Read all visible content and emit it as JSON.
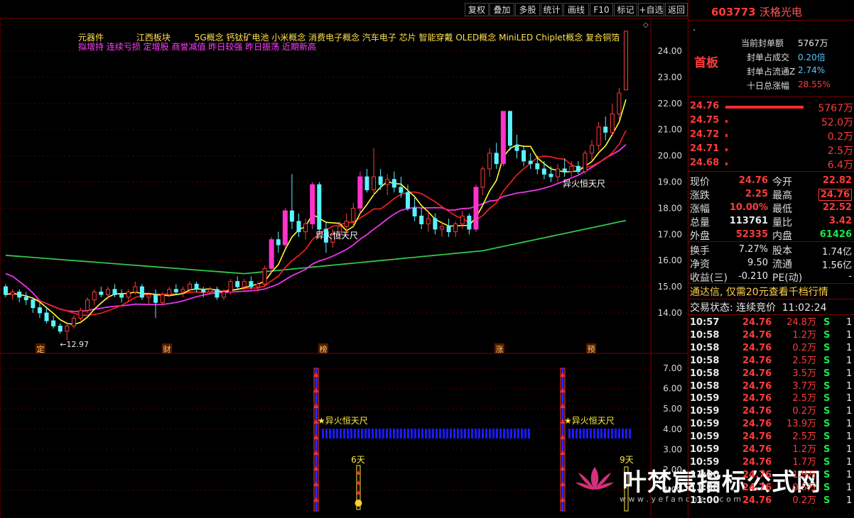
{
  "toolbar": {
    "buttons": [
      "复权",
      "叠加",
      "多股",
      "统计",
      "画线",
      "F10",
      "标记",
      "+自选",
      "返回"
    ]
  },
  "stock": {
    "code": "603773",
    "name": "沃格光电",
    "board": "首板"
  },
  "seal": [
    {
      "label": "当前封单额",
      "value": "5767万"
    },
    {
      "label": "封单占成交",
      "value": "0.20倍"
    },
    {
      "label": "封单占流通Z",
      "value": "2.74%"
    },
    {
      "label": "十日总涨幅",
      "value": "28.55%"
    }
  ],
  "bids": [
    {
      "price": "24.76",
      "vol": "5767万",
      "bar": 1.0
    },
    {
      "price": "24.75",
      "vol": "52.0万",
      "bar": 0.0
    },
    {
      "price": "24.72",
      "vol": "0.2万",
      "bar": 0.0
    },
    {
      "price": "24.71",
      "vol": "2.5万",
      "bar": 0.0
    },
    {
      "price": "24.68",
      "vol": "6.4万",
      "bar": 0.0
    }
  ],
  "quote": [
    {
      "l1": "现价",
      "v1": "24.76",
      "c1": "red",
      "l2": "今开",
      "v2": "22.82",
      "c2": "red"
    },
    {
      "l1": "涨跌",
      "v1": "2.25",
      "c1": "red",
      "l2": "最高",
      "v2": "24.76",
      "c2": "red"
    },
    {
      "l1": "涨幅",
      "v1": "10.00%",
      "c1": "red",
      "l2": "最低",
      "v2": "22.52",
      "c2": "red"
    },
    {
      "l1": "总量",
      "v1": "113761",
      "c1": "wht",
      "l2": "量比",
      "v2": "3.42",
      "c2": "red"
    },
    {
      "l1": "外盘",
      "v1": "52335",
      "c1": "red",
      "l2": "内盘",
      "v2": "61426",
      "c2": "grn"
    }
  ],
  "fund": [
    {
      "l1": "换手",
      "v1": "7.27%",
      "l2": "股本",
      "v2": "1.74亿"
    },
    {
      "l1": "净资",
      "v1": "9.50",
      "l2": "流通",
      "v2": "1.56亿"
    },
    {
      "l1": "收益(三)",
      "v1": "-0.210",
      "l2": "PE(动)",
      "v2": "-"
    }
  ],
  "notice": "通达信, 仅需20元查看千档行情",
  "status": {
    "label": "交易状态: 连续竞价",
    "time": "11:02:24"
  },
  "ticks": [
    {
      "t": "10:57",
      "p": "24.76",
      "v": "24.8万",
      "s": "S",
      "n": "1"
    },
    {
      "t": "10:58",
      "p": "24.76",
      "v": "1.2万",
      "s": "S",
      "n": "1"
    },
    {
      "t": "10:58",
      "p": "24.76",
      "v": "0.2万",
      "s": "S",
      "n": "1"
    },
    {
      "t": "10:58",
      "p": "24.76",
      "v": "2.5万",
      "s": "S",
      "n": "1"
    },
    {
      "t": "10:58",
      "p": "24.76",
      "v": "3.5万",
      "s": "S",
      "n": "1"
    },
    {
      "t": "10:58",
      "p": "24.76",
      "v": "3.7万",
      "s": "S",
      "n": "1"
    },
    {
      "t": "10:59",
      "p": "24.76",
      "v": "2.5万",
      "s": "S",
      "n": "1"
    },
    {
      "t": "10:59",
      "p": "24.76",
      "v": "0.2万",
      "s": "S",
      "n": "1"
    },
    {
      "t": "10:59",
      "p": "24.76",
      "v": "13.9万",
      "s": "S",
      "n": "1"
    },
    {
      "t": "10:59",
      "p": "24.76",
      "v": "2.5万",
      "s": "S",
      "n": "1"
    },
    {
      "t": "10:59",
      "p": "24.76",
      "v": "1.2万",
      "s": "S",
      "n": "1"
    },
    {
      "t": "10:59",
      "p": "24.76",
      "v": "1.7万",
      "s": "S",
      "n": "1"
    },
    {
      "t": "11:00",
      "p": "24.76",
      "v": "1.9万",
      "s": "S",
      "n": "1"
    },
    {
      "t": "11:00",
      "p": "24.76",
      "v": "0.5万",
      "s": "S",
      "n": "1"
    },
    {
      "t": "11:00",
      "p": "24.76",
      "v": "0.2万",
      "s": "S",
      "n": "1"
    }
  ],
  "concepts": {
    "line1": [
      "元器件",
      "江西板块",
      "5G概念 钙钛矿电池 小米概念 消费电子概念 汽车电子 芯片 智能穿戴 OLED概念 MiniLED Chiplet概念 复合铜箔"
    ],
    "line2": "拟增持 连续亏损 定增股 商誉减值 昨日较强 昨日振荡 近期新高"
  },
  "markers": {
    "low": "12.97",
    "signal": "异火恒天尺",
    "days1": "6天",
    "days2": "9天",
    "bottom": [
      "定",
      "财",
      "榜",
      "涨",
      "预"
    ]
  },
  "watermark": {
    "text": "叶梵宸指标公式网",
    "url": "w w w . y e f a n c h e n . c o m"
  },
  "colors": {
    "up": "#ff3b3b",
    "down": "#5cf2ff",
    "ma5": "#ffff33",
    "ma10": "#ff2020",
    "ma20": "#ee33ee",
    "ma60": "#2fc84a",
    "signal": "#ff33cc",
    "label": "#ffd24a"
  },
  "chart_data": {
    "type": "candlestick",
    "yaxis_main": [
      "24.00",
      "23.00",
      "22.00",
      "21.00",
      "20.00",
      "19.00",
      "18.00",
      "17.00",
      "16.00",
      "15.00",
      "14.00"
    ],
    "yaxis_sub": [
      "7.00",
      "6.00",
      "5.00",
      "4.00",
      "3.00",
      "2.00",
      "1.00"
    ],
    "ohlc": [
      [
        15.0,
        15.1,
        14.6,
        14.7
      ],
      [
        14.7,
        14.9,
        14.5,
        14.8
      ],
      [
        14.8,
        14.9,
        14.4,
        14.6
      ],
      [
        14.6,
        14.8,
        14.3,
        14.5
      ],
      [
        14.5,
        14.6,
        14.0,
        14.2
      ],
      [
        14.2,
        14.4,
        13.8,
        14.0
      ],
      [
        14.0,
        14.2,
        13.6,
        13.7
      ],
      [
        13.7,
        13.9,
        13.4,
        13.5
      ],
      [
        13.5,
        13.6,
        13.2,
        13.3
      ],
      [
        13.3,
        13.6,
        12.97,
        13.5
      ],
      [
        13.5,
        13.9,
        13.4,
        13.8
      ],
      [
        13.8,
        14.2,
        13.7,
        14.1
      ],
      [
        14.1,
        14.6,
        14.0,
        14.5
      ],
      [
        14.5,
        14.9,
        14.3,
        14.8
      ],
      [
        14.8,
        15.0,
        14.6,
        14.7
      ],
      [
        14.7,
        15.0,
        14.5,
        14.9
      ],
      [
        14.9,
        15.1,
        14.6,
        14.7
      ],
      [
        14.7,
        14.9,
        14.4,
        14.6
      ],
      [
        14.6,
        14.9,
        14.4,
        14.8
      ],
      [
        14.8,
        15.2,
        14.7,
        15.0
      ],
      [
        15.0,
        15.1,
        14.5,
        14.6
      ],
      [
        14.6,
        14.8,
        14.3,
        14.7
      ],
      [
        14.7,
        14.9,
        13.8,
        14.4
      ],
      [
        14.4,
        14.8,
        14.3,
        14.7
      ],
      [
        14.7,
        15.0,
        14.6,
        14.9
      ],
      [
        14.9,
        15.1,
        14.7,
        14.8
      ],
      [
        14.8,
        15.0,
        14.6,
        14.9
      ],
      [
        14.9,
        15.2,
        14.8,
        15.1
      ],
      [
        15.1,
        15.2,
        14.8,
        14.9
      ],
      [
        14.9,
        15.0,
        14.6,
        14.8
      ],
      [
        14.8,
        15.0,
        14.7,
        14.9
      ],
      [
        14.9,
        15.0,
        14.5,
        14.6
      ],
      [
        14.6,
        14.9,
        14.5,
        14.8
      ],
      [
        14.8,
        15.3,
        14.7,
        15.2
      ],
      [
        15.2,
        15.4,
        14.9,
        15.0
      ],
      [
        15.0,
        15.3,
        14.8,
        15.2
      ],
      [
        15.2,
        15.4,
        14.9,
        15.0
      ],
      [
        15.0,
        15.2,
        14.8,
        15.1
      ],
      [
        15.1,
        15.8,
        15.0,
        15.7
      ],
      [
        15.7,
        16.9,
        15.5,
        16.8
      ],
      [
        16.8,
        17.1,
        16.3,
        16.6
      ],
      [
        16.6,
        18.0,
        16.5,
        17.9
      ],
      [
        17.9,
        19.3,
        17.2,
        17.5
      ],
      [
        17.5,
        17.8,
        16.9,
        17.1
      ],
      [
        17.1,
        17.6,
        16.8,
        17.4
      ],
      [
        17.4,
        19.0,
        17.2,
        18.9
      ],
      [
        18.9,
        19.0,
        17.0,
        17.2
      ],
      [
        17.2,
        17.5,
        16.3,
        16.7
      ],
      [
        16.7,
        17.2,
        16.5,
        17.0
      ],
      [
        17.0,
        17.5,
        16.8,
        17.3
      ],
      [
        17.3,
        17.8,
        17.0,
        17.5
      ],
      [
        17.5,
        18.2,
        17.3,
        18.0
      ],
      [
        18.0,
        19.4,
        17.8,
        19.2
      ],
      [
        19.2,
        19.5,
        18.6,
        18.7
      ],
      [
        18.7,
        20.3,
        18.5,
        19.2
      ],
      [
        19.2,
        19.5,
        18.7,
        18.9
      ],
      [
        18.9,
        19.3,
        18.5,
        19.1
      ],
      [
        19.1,
        19.4,
        18.6,
        18.8
      ],
      [
        18.8,
        19.2,
        18.4,
        18.6
      ],
      [
        18.6,
        18.9,
        17.9,
        18.0
      ],
      [
        18.0,
        18.4,
        17.5,
        17.7
      ],
      [
        17.7,
        18.0,
        17.2,
        17.4
      ],
      [
        17.4,
        17.9,
        17.1,
        17.6
      ],
      [
        17.6,
        17.8,
        17.0,
        17.2
      ],
      [
        17.2,
        17.5,
        16.9,
        17.3
      ],
      [
        17.3,
        17.6,
        16.9,
        17.1
      ],
      [
        17.1,
        17.5,
        16.9,
        17.4
      ],
      [
        17.4,
        17.9,
        17.2,
        17.7
      ],
      [
        17.7,
        17.8,
        17.0,
        17.2
      ],
      [
        17.2,
        18.9,
        17.1,
        18.8
      ],
      [
        18.8,
        19.6,
        18.5,
        19.5
      ],
      [
        19.5,
        20.3,
        19.2,
        20.1
      ],
      [
        20.1,
        20.5,
        19.5,
        19.7
      ],
      [
        19.7,
        21.7,
        19.6,
        21.7
      ],
      [
        21.7,
        21.7,
        20.2,
        20.4
      ],
      [
        20.4,
        20.8,
        19.9,
        20.2
      ],
      [
        20.2,
        20.4,
        19.6,
        19.8
      ],
      [
        19.8,
        20.1,
        19.5,
        19.7
      ],
      [
        19.7,
        20.0,
        19.3,
        19.5
      ],
      [
        19.5,
        19.8,
        19.1,
        19.3
      ],
      [
        19.3,
        19.6,
        19.0,
        19.2
      ],
      [
        19.2,
        19.7,
        19.0,
        19.5
      ],
      [
        19.5,
        19.9,
        19.2,
        19.4
      ],
      [
        19.4,
        19.8,
        19.2,
        19.6
      ],
      [
        19.6,
        19.8,
        19.3,
        19.4
      ],
      [
        19.4,
        20.2,
        19.3,
        20.1
      ],
      [
        20.1,
        20.6,
        19.8,
        20.4
      ],
      [
        20.4,
        21.3,
        20.2,
        21.1
      ],
      [
        21.1,
        21.5,
        20.6,
        20.9
      ],
      [
        20.9,
        22.0,
        20.8,
        21.6
      ],
      [
        21.6,
        22.6,
        21.4,
        22.4
      ],
      [
        22.52,
        24.76,
        22.52,
        24.76
      ]
    ]
  }
}
